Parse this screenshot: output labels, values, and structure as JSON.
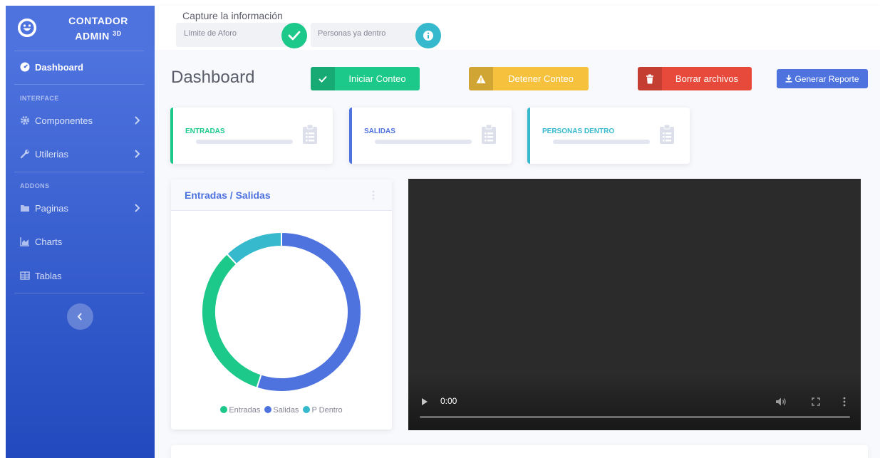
{
  "brand": {
    "line1": "CONTADOR",
    "line2": "ADMIN",
    "sup": "3D"
  },
  "sidebar": {
    "dashboard": "Dashboard",
    "heading_interface": "INTERFACE",
    "componentes": "Componentes",
    "utilerias": "Utilerias",
    "heading_addons": "ADDONS",
    "paginas": "Paginas",
    "charts": "Charts",
    "tablas": "Tablas"
  },
  "topbar": {
    "capture_title": "Capture la información",
    "limit_label": "Límite de Aforo",
    "inside_label": "Personas ya dentro"
  },
  "main": {
    "title": "Dashboard",
    "buttons": {
      "start": "Iniciar Conteo",
      "stop": "Detener Conteo",
      "delete": "Borrar archivos",
      "report": "Generar Reporte"
    },
    "cards": {
      "entradas": "ENTRADAS",
      "salidas": "SALIDAS",
      "dentro": "PERSONAS DENTRO"
    },
    "chart_card_title": "Entradas / Salidas",
    "video_time": "0:00"
  },
  "colors": {
    "primary": "#4e73df",
    "success": "#1cc88a",
    "warning": "#f6c23e",
    "danger": "#e74a3b",
    "info": "#36b9cc"
  },
  "chart_data": {
    "type": "pie",
    "title": "Entradas / Salidas",
    "categories": [
      "Entradas",
      "Salidas",
      "P Dentro"
    ],
    "values": [
      33,
      55,
      12
    ],
    "colors": [
      "#1cc88a",
      "#4e73df",
      "#36b9cc"
    ],
    "legend": "bottom"
  }
}
